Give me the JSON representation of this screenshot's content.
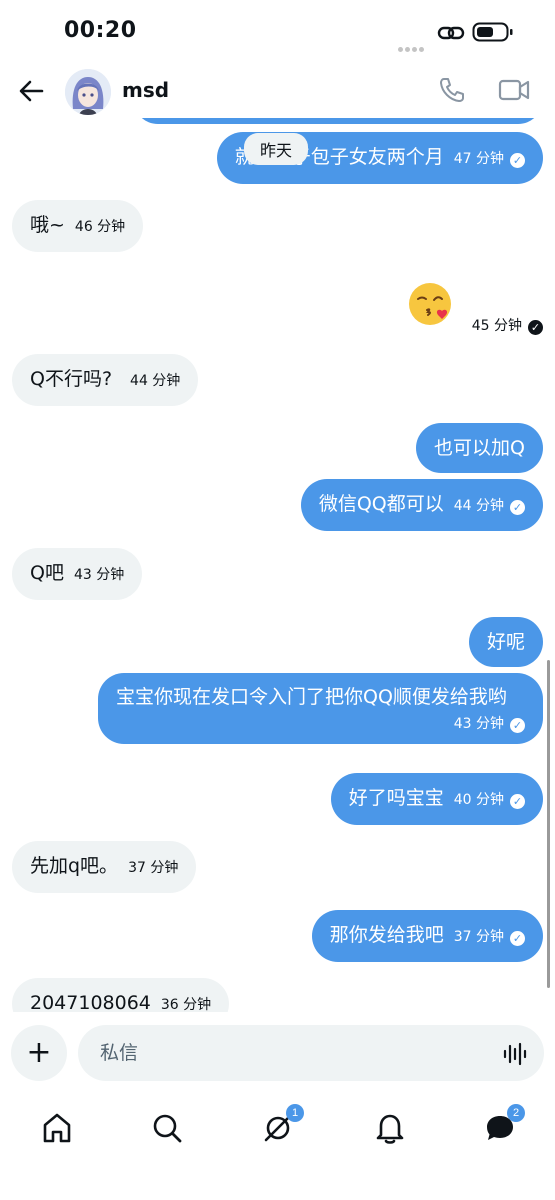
{
  "status_bar": {
    "time": "00:20"
  },
  "header": {
    "contact_name": "msd"
  },
  "chat": {
    "date_divider": "昨天",
    "messages": [
      {
        "text": "就相当于包子女友两个月",
        "time": "47 分钟"
      },
      {
        "text": "哦~",
        "time": "46 分钟"
      },
      {
        "text": "😘",
        "time": "45 分钟"
      },
      {
        "text": "Q不行吗?",
        "time": "44 分钟"
      },
      {
        "text": "也可以加Q",
        "time": ""
      },
      {
        "text": "微信QQ都可以",
        "time": "44 分钟"
      },
      {
        "text": "Q吧",
        "time": "43 分钟"
      },
      {
        "text": "好呢",
        "time": ""
      },
      {
        "text": "宝宝你现在发口令入门了把你QQ顺便发给我哟",
        "time": "43 分钟"
      },
      {
        "text": "好了吗宝宝",
        "time": "40 分钟"
      },
      {
        "text": "先加q吧。",
        "time": "37 分钟"
      },
      {
        "text": "那你发给我吧",
        "time": "37 分钟"
      },
      {
        "text": "2047108064",
        "time": "36 分钟"
      }
    ]
  },
  "composer": {
    "placeholder": "私信"
  },
  "bottom_nav": {
    "items": [
      {
        "icon": "home-icon"
      },
      {
        "icon": "search-icon"
      },
      {
        "icon": "grok-icon",
        "badge": "1"
      },
      {
        "icon": "bell-icon"
      },
      {
        "icon": "messages-icon",
        "badge": "2"
      }
    ]
  },
  "colors": {
    "accent": "#4b97e8",
    "incoming_bubble": "#eff3f4",
    "text": "#0f1419"
  }
}
